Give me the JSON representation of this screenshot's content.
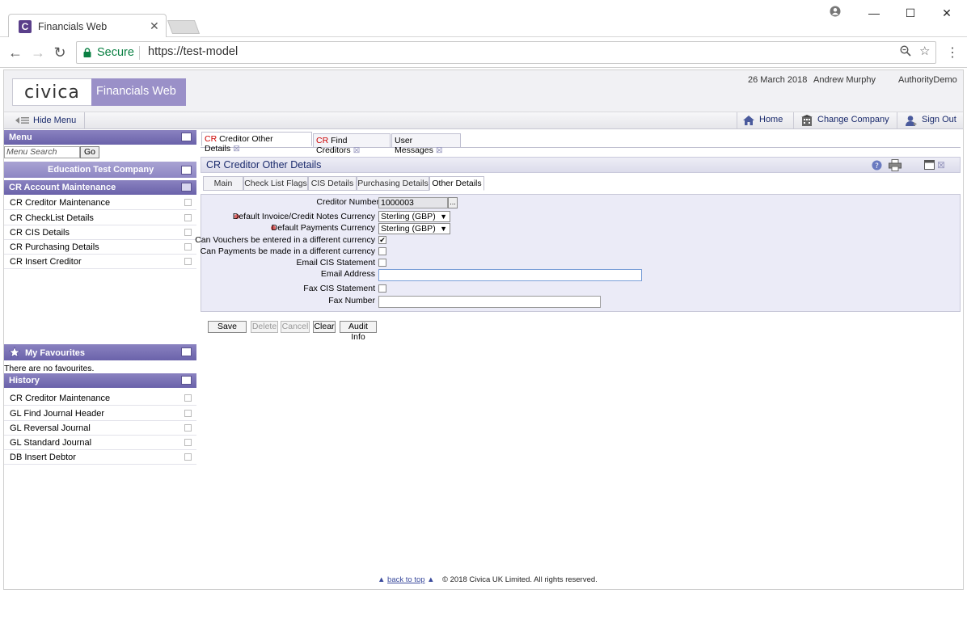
{
  "browser": {
    "tab_title": "Financials Web",
    "secure_label": "Secure",
    "url": "https://test-model"
  },
  "app": {
    "logo": "civica",
    "product": "Financials Web",
    "date": "26 March 2018",
    "user": "Andrew Murphy",
    "authority": "AuthorityDemo",
    "hide_menu": "Hide Menu",
    "nav": {
      "home": "Home",
      "change_company": "Change Company",
      "sign_out": "Sign Out"
    }
  },
  "sidebar": {
    "menu_title": "Menu",
    "search_placeholder": "Menu Search",
    "go": "Go",
    "company": "Education Test Company",
    "section_title": "CR Account Maintenance",
    "items": [
      {
        "label": "CR Creditor Maintenance"
      },
      {
        "label": "CR CheckList Details"
      },
      {
        "label": "CR CIS Details"
      },
      {
        "label": "CR Purchasing Details"
      },
      {
        "label": "CR Insert Creditor"
      }
    ],
    "favourites_title": "My Favourites",
    "no_favourites": "There are no favourites.",
    "history_title": "History",
    "history": [
      {
        "label": "CR Creditor Maintenance"
      },
      {
        "label": "GL Find Journal Header"
      },
      {
        "label": "GL Reversal Journal"
      },
      {
        "label": "GL Standard Journal"
      },
      {
        "label": "DB Insert Debtor"
      }
    ]
  },
  "tabs": [
    {
      "prefix": "CR",
      "label": "Creditor Other Details"
    },
    {
      "prefix": "CR",
      "label": "Find Creditors"
    },
    {
      "prefix": "",
      "label": "User Messages"
    }
  ],
  "panel_title": "CR Creditor Other Details",
  "sub_tabs": [
    "Main",
    "Check List Flags",
    "CIS Details",
    "Purchasing Details",
    "Other Details"
  ],
  "form": {
    "creditor_number_label": "Creditor Number",
    "creditor_number": "1000003",
    "invoice_currency_label": "Default Invoice/Credit Notes Currency",
    "invoice_currency": "Sterling (GBP)",
    "payment_currency_label": "Default Payments Currency",
    "payment_currency": "Sterling (GBP)",
    "vouchers_label": "Can Vouchers be entered in a different currency",
    "payments_label": "Can Payments be made in a different currency",
    "email_cis_label": "Email CIS Statement",
    "email_address_label": "Email Address",
    "fax_cis_label": "Fax CIS Statement",
    "fax_number_label": "Fax Number"
  },
  "buttons": {
    "save": "Save",
    "delete": "Delete",
    "cancel": "Cancel",
    "clear": "Clear",
    "audit": "Audit Info"
  },
  "footer": {
    "back_to_top": "back to top",
    "copyright": "© 2018 Civica UK Limited. All rights reserved."
  },
  "colors": {
    "accent": "#7a72b8",
    "link": "#1a2a6c",
    "required": "#e06060",
    "secure": "#0b8043"
  }
}
